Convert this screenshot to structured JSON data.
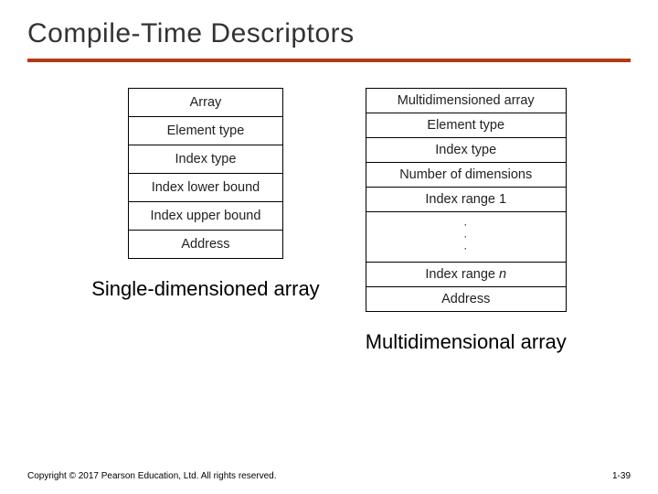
{
  "title": "Compile-Time Descriptors",
  "left": {
    "rows": [
      "Array",
      "Element type",
      "Index type",
      "Index lower bound",
      "Index upper bound",
      "Address"
    ],
    "caption": "Single-dimensioned array"
  },
  "right": {
    "rows_top": [
      "Multidimensioned array",
      "Element type",
      "Index type",
      "Number of dimensions",
      "Index range 1"
    ],
    "row_range_n_prefix": "Index range ",
    "row_range_n_var": "n",
    "row_address": "Address",
    "caption": "Multidimensional array"
  },
  "footer": {
    "copyright": "Copyright © 2017 Pearson Education, Ltd. All rights reserved.",
    "page": "1-39"
  }
}
